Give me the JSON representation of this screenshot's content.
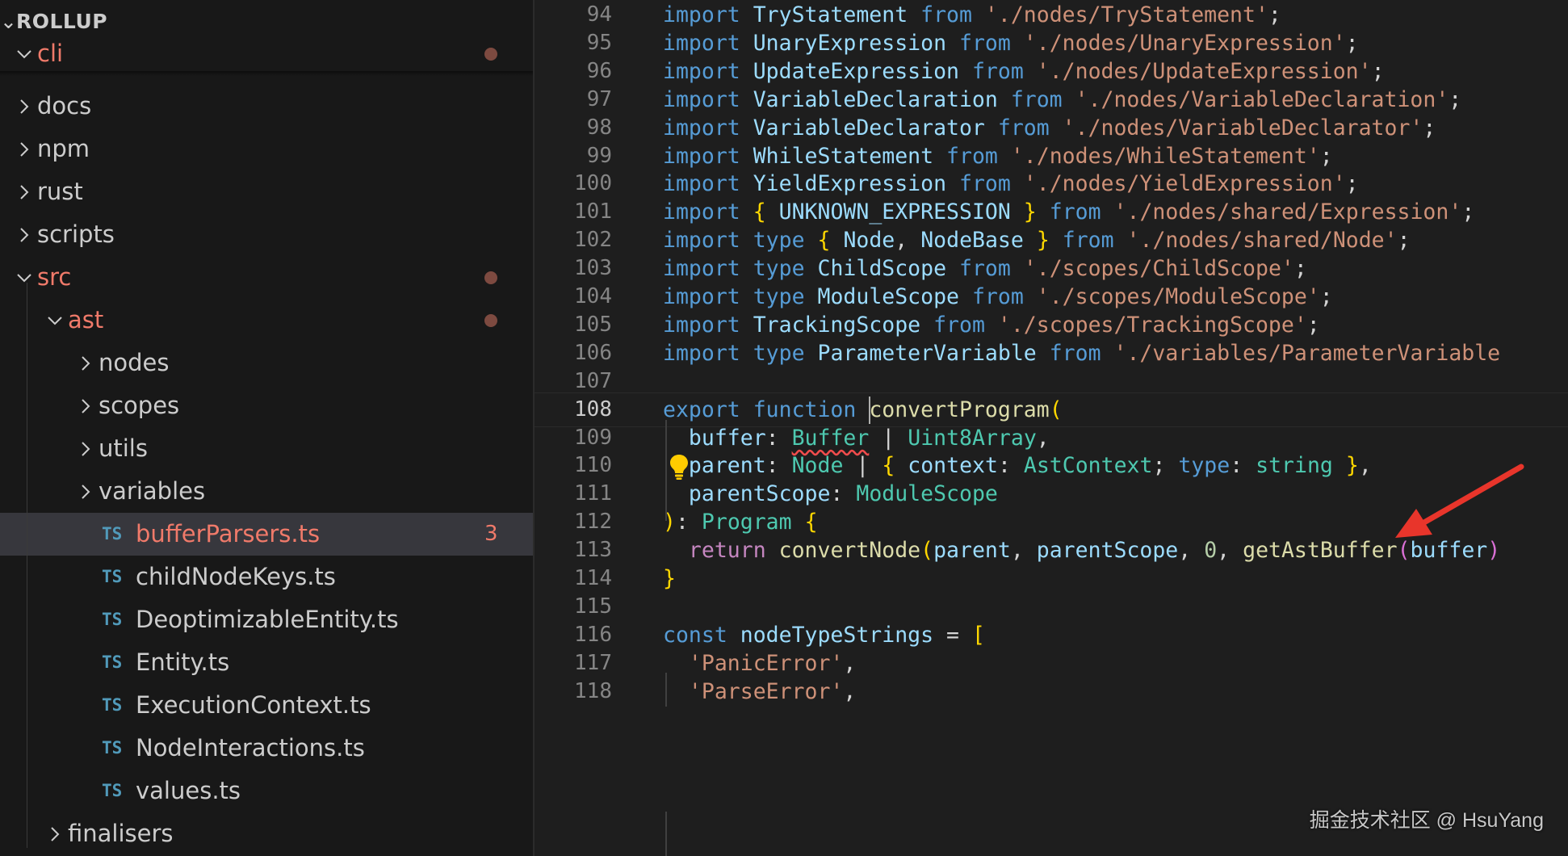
{
  "explorer": {
    "section_title": "ROLLUP",
    "items": [
      {
        "label": "cli",
        "kind": "folder",
        "expanded": true,
        "modified": true
      },
      {
        "label": "docs",
        "kind": "folder",
        "expanded": false
      },
      {
        "label": "npm",
        "kind": "folder",
        "expanded": false
      },
      {
        "label": "rust",
        "kind": "folder",
        "expanded": false
      },
      {
        "label": "scripts",
        "kind": "folder",
        "expanded": false
      },
      {
        "label": "src",
        "kind": "folder",
        "expanded": true,
        "modified": true
      },
      {
        "label": "ast",
        "kind": "folder",
        "expanded": true,
        "modified": true
      },
      {
        "label": "nodes",
        "kind": "folder",
        "expanded": false
      },
      {
        "label": "scopes",
        "kind": "folder",
        "expanded": false
      },
      {
        "label": "utils",
        "kind": "folder",
        "expanded": false
      },
      {
        "label": "variables",
        "kind": "folder",
        "expanded": false
      },
      {
        "label": "bufferParsers.ts",
        "kind": "file",
        "selected": true,
        "modified": true,
        "problems": "3"
      },
      {
        "label": "childNodeKeys.ts",
        "kind": "file"
      },
      {
        "label": "DeoptimizableEntity.ts",
        "kind": "file"
      },
      {
        "label": "Entity.ts",
        "kind": "file"
      },
      {
        "label": "ExecutionContext.ts",
        "kind": "file"
      },
      {
        "label": "NodeInteractions.ts",
        "kind": "file"
      },
      {
        "label": "values.ts",
        "kind": "file"
      },
      {
        "label": "finalisers",
        "kind": "folder",
        "expanded": false
      }
    ],
    "ts_badge": "TS"
  },
  "editor": {
    "current_line": 108,
    "lines": [
      {
        "n": "94",
        "code": "import TryStatement from './nodes/TryStatement';"
      },
      {
        "n": "95",
        "code": "import UnaryExpression from './nodes/UnaryExpression';"
      },
      {
        "n": "96",
        "code": "import UpdateExpression from './nodes/UpdateExpression';"
      },
      {
        "n": "97",
        "code": "import VariableDeclaration from './nodes/VariableDeclaration';"
      },
      {
        "n": "98",
        "code": "import VariableDeclarator from './nodes/VariableDeclarator';"
      },
      {
        "n": "99",
        "code": "import WhileStatement from './nodes/WhileStatement';"
      },
      {
        "n": "100",
        "code": "import YieldExpression from './nodes/YieldExpression';"
      },
      {
        "n": "101",
        "code": "import { UNKNOWN_EXPRESSION } from './nodes/shared/Expression';"
      },
      {
        "n": "102",
        "code": "import type { Node, NodeBase } from './nodes/shared/Node';"
      },
      {
        "n": "103",
        "code": "import type ChildScope from './scopes/ChildScope';"
      },
      {
        "n": "104",
        "code": "import type ModuleScope from './scopes/ModuleScope';"
      },
      {
        "n": "105",
        "code": "import TrackingScope from './scopes/TrackingScope';"
      },
      {
        "n": "106",
        "code": "import type ParameterVariable from './variables/ParameterVariable"
      },
      {
        "n": "107",
        "code": ""
      },
      {
        "n": "108",
        "code": "export function convertProgram("
      },
      {
        "n": "109",
        "code": "  buffer: Buffer | Uint8Array,"
      },
      {
        "n": "110",
        "code": "  parent: Node | { context: AstContext; type: string },"
      },
      {
        "n": "111",
        "code": "  parentScope: ModuleScope"
      },
      {
        "n": "112",
        "code": "): Program {"
      },
      {
        "n": "113",
        "code": "  return convertNode(parent, parentScope, 0, getAstBuffer(buffer)"
      },
      {
        "n": "114",
        "code": "}"
      },
      {
        "n": "115",
        "code": ""
      },
      {
        "n": "116",
        "code": "const nodeTypeStrings = ["
      },
      {
        "n": "117",
        "code": "  'PanicError',"
      },
      {
        "n": "118",
        "code": "  'ParseError',"
      }
    ]
  },
  "annotation": {
    "arrow_color": "#e8352b"
  },
  "watermark": "掘金技术社区 @ HsuYang"
}
